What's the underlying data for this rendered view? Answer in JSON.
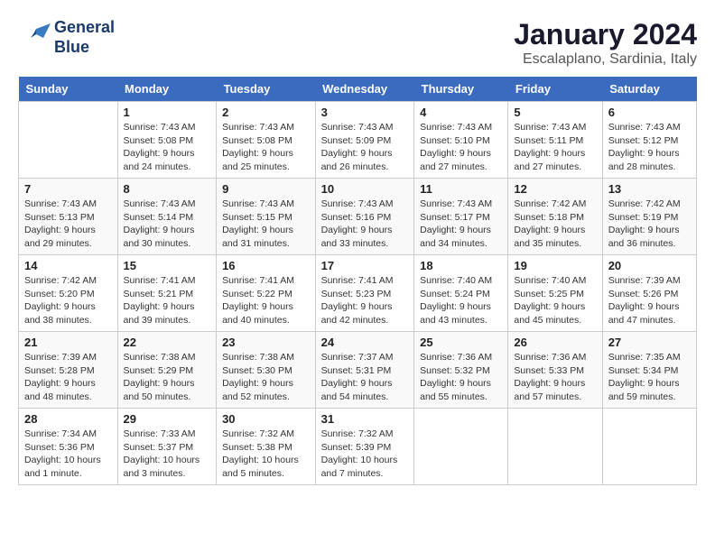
{
  "logo": {
    "line1": "General",
    "line2": "Blue"
  },
  "title": "January 2024",
  "subtitle": "Escalaplano, Sardinia, Italy",
  "days_of_week": [
    "Sunday",
    "Monday",
    "Tuesday",
    "Wednesday",
    "Thursday",
    "Friday",
    "Saturday"
  ],
  "weeks": [
    [
      {
        "day": "",
        "info": ""
      },
      {
        "day": "1",
        "info": "Sunrise: 7:43 AM\nSunset: 5:08 PM\nDaylight: 9 hours\nand 24 minutes."
      },
      {
        "day": "2",
        "info": "Sunrise: 7:43 AM\nSunset: 5:08 PM\nDaylight: 9 hours\nand 25 minutes."
      },
      {
        "day": "3",
        "info": "Sunrise: 7:43 AM\nSunset: 5:09 PM\nDaylight: 9 hours\nand 26 minutes."
      },
      {
        "day": "4",
        "info": "Sunrise: 7:43 AM\nSunset: 5:10 PM\nDaylight: 9 hours\nand 27 minutes."
      },
      {
        "day": "5",
        "info": "Sunrise: 7:43 AM\nSunset: 5:11 PM\nDaylight: 9 hours\nand 27 minutes."
      },
      {
        "day": "6",
        "info": "Sunrise: 7:43 AM\nSunset: 5:12 PM\nDaylight: 9 hours\nand 28 minutes."
      }
    ],
    [
      {
        "day": "7",
        "info": "Sunrise: 7:43 AM\nSunset: 5:13 PM\nDaylight: 9 hours\nand 29 minutes."
      },
      {
        "day": "8",
        "info": "Sunrise: 7:43 AM\nSunset: 5:14 PM\nDaylight: 9 hours\nand 30 minutes."
      },
      {
        "day": "9",
        "info": "Sunrise: 7:43 AM\nSunset: 5:15 PM\nDaylight: 9 hours\nand 31 minutes."
      },
      {
        "day": "10",
        "info": "Sunrise: 7:43 AM\nSunset: 5:16 PM\nDaylight: 9 hours\nand 33 minutes."
      },
      {
        "day": "11",
        "info": "Sunrise: 7:43 AM\nSunset: 5:17 PM\nDaylight: 9 hours\nand 34 minutes."
      },
      {
        "day": "12",
        "info": "Sunrise: 7:42 AM\nSunset: 5:18 PM\nDaylight: 9 hours\nand 35 minutes."
      },
      {
        "day": "13",
        "info": "Sunrise: 7:42 AM\nSunset: 5:19 PM\nDaylight: 9 hours\nand 36 minutes."
      }
    ],
    [
      {
        "day": "14",
        "info": "Sunrise: 7:42 AM\nSunset: 5:20 PM\nDaylight: 9 hours\nand 38 minutes."
      },
      {
        "day": "15",
        "info": "Sunrise: 7:41 AM\nSunset: 5:21 PM\nDaylight: 9 hours\nand 39 minutes."
      },
      {
        "day": "16",
        "info": "Sunrise: 7:41 AM\nSunset: 5:22 PM\nDaylight: 9 hours\nand 40 minutes."
      },
      {
        "day": "17",
        "info": "Sunrise: 7:41 AM\nSunset: 5:23 PM\nDaylight: 9 hours\nand 42 minutes."
      },
      {
        "day": "18",
        "info": "Sunrise: 7:40 AM\nSunset: 5:24 PM\nDaylight: 9 hours\nand 43 minutes."
      },
      {
        "day": "19",
        "info": "Sunrise: 7:40 AM\nSunset: 5:25 PM\nDaylight: 9 hours\nand 45 minutes."
      },
      {
        "day": "20",
        "info": "Sunrise: 7:39 AM\nSunset: 5:26 PM\nDaylight: 9 hours\nand 47 minutes."
      }
    ],
    [
      {
        "day": "21",
        "info": "Sunrise: 7:39 AM\nSunset: 5:28 PM\nDaylight: 9 hours\nand 48 minutes."
      },
      {
        "day": "22",
        "info": "Sunrise: 7:38 AM\nSunset: 5:29 PM\nDaylight: 9 hours\nand 50 minutes."
      },
      {
        "day": "23",
        "info": "Sunrise: 7:38 AM\nSunset: 5:30 PM\nDaylight: 9 hours\nand 52 minutes."
      },
      {
        "day": "24",
        "info": "Sunrise: 7:37 AM\nSunset: 5:31 PM\nDaylight: 9 hours\nand 54 minutes."
      },
      {
        "day": "25",
        "info": "Sunrise: 7:36 AM\nSunset: 5:32 PM\nDaylight: 9 hours\nand 55 minutes."
      },
      {
        "day": "26",
        "info": "Sunrise: 7:36 AM\nSunset: 5:33 PM\nDaylight: 9 hours\nand 57 minutes."
      },
      {
        "day": "27",
        "info": "Sunrise: 7:35 AM\nSunset: 5:34 PM\nDaylight: 9 hours\nand 59 minutes."
      }
    ],
    [
      {
        "day": "28",
        "info": "Sunrise: 7:34 AM\nSunset: 5:36 PM\nDaylight: 10 hours\nand 1 minute."
      },
      {
        "day": "29",
        "info": "Sunrise: 7:33 AM\nSunset: 5:37 PM\nDaylight: 10 hours\nand 3 minutes."
      },
      {
        "day": "30",
        "info": "Sunrise: 7:32 AM\nSunset: 5:38 PM\nDaylight: 10 hours\nand 5 minutes."
      },
      {
        "day": "31",
        "info": "Sunrise: 7:32 AM\nSunset: 5:39 PM\nDaylight: 10 hours\nand 7 minutes."
      },
      {
        "day": "",
        "info": ""
      },
      {
        "day": "",
        "info": ""
      },
      {
        "day": "",
        "info": ""
      }
    ]
  ]
}
